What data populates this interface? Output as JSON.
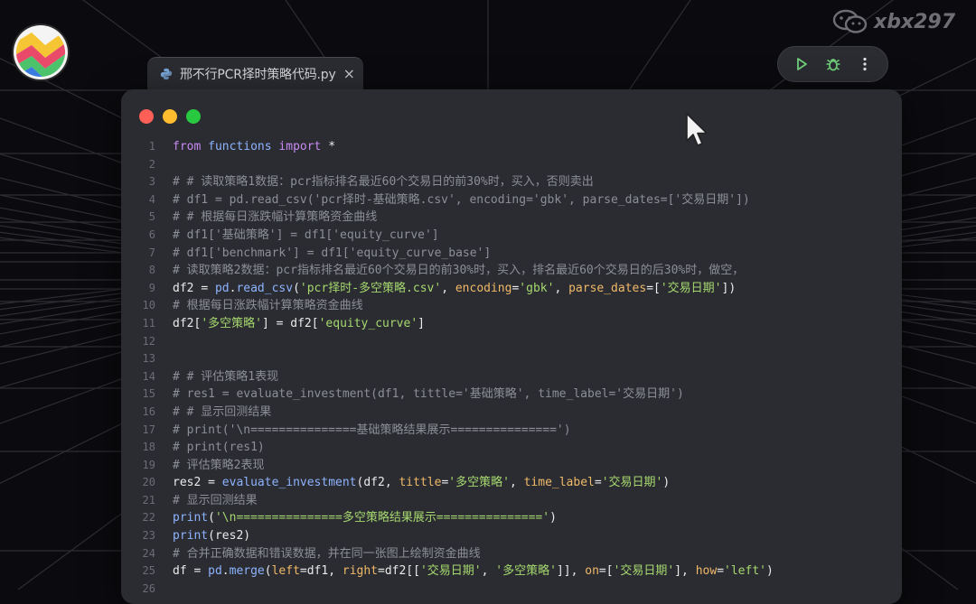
{
  "watermark": {
    "text": "xbx297"
  },
  "tab": {
    "title": "邢不行PCR择时策略代码.py",
    "close": "×"
  },
  "toolbar": {
    "run": "run-icon",
    "debug": "bug-icon",
    "more": "more-vertical-icon"
  },
  "colors": {
    "background": "#0b0b0f",
    "editor": "#2b2c31",
    "comment": "#8c8f98",
    "keyword": "#c78bf3",
    "function": "#8db3ff",
    "string": "#a6d86f",
    "parameter": "#f0b969",
    "traffic_red": "#fe5f57",
    "traffic_yellow": "#febc2e",
    "traffic_green": "#28c840"
  },
  "code_lines": [
    {
      "n": "1",
      "t": [
        [
          "kw",
          "from "
        ],
        [
          "fn",
          "functions "
        ],
        [
          "kw",
          "import "
        ],
        [
          "op",
          "*"
        ]
      ]
    },
    {
      "n": "2",
      "t": []
    },
    {
      "n": "3",
      "t": [
        [
          "cm",
          "# # 读取策略1数据：pcr指标排名最近60个交易日的前30%时，买入，否则卖出"
        ]
      ]
    },
    {
      "n": "4",
      "t": [
        [
          "cm",
          "# df1 = pd.read_csv('pcr择时-基础策略.csv', encoding='gbk', parse_dates=['交易日期'])"
        ]
      ]
    },
    {
      "n": "5",
      "t": [
        [
          "cm",
          "# # 根据每日涨跌幅计算策略资金曲线"
        ]
      ]
    },
    {
      "n": "6",
      "t": [
        [
          "cm",
          "# df1['基础策略'] = df1['equity_curve']"
        ]
      ]
    },
    {
      "n": "7",
      "t": [
        [
          "cm",
          "# df1['benchmark'] = df1['equity_curve_base']"
        ]
      ]
    },
    {
      "n": "8",
      "t": [
        [
          "cm",
          "# 读取策略2数据：pcr指标排名最近60个交易日的前30%时，买入，排名最近60个交易日的后30%时，做空，"
        ]
      ]
    },
    {
      "n": "9",
      "t": [
        [
          "var",
          "df2 "
        ],
        [
          "op",
          "= "
        ],
        [
          "fn",
          "pd"
        ],
        [
          "op",
          "."
        ],
        [
          "fn",
          "read_csv"
        ],
        [
          "op",
          "("
        ],
        [
          "str",
          "'pcr择时-多空策略.csv'"
        ],
        [
          "op",
          ", "
        ],
        [
          "param",
          "encoding"
        ],
        [
          "op",
          "="
        ],
        [
          "str",
          "'gbk'"
        ],
        [
          "op",
          ", "
        ],
        [
          "param",
          "parse_dates"
        ],
        [
          "op",
          "=["
        ],
        [
          "str",
          "'交易日期'"
        ],
        [
          "op",
          "])"
        ]
      ]
    },
    {
      "n": "10",
      "t": [
        [
          "cm",
          "# 根据每日涨跌幅计算策略资金曲线"
        ]
      ]
    },
    {
      "n": "11",
      "t": [
        [
          "var",
          "df2"
        ],
        [
          "op",
          "["
        ],
        [
          "str",
          "'多空策略'"
        ],
        [
          "op",
          "] = "
        ],
        [
          "var",
          "df2"
        ],
        [
          "op",
          "["
        ],
        [
          "str",
          "'equity_curve'"
        ],
        [
          "op",
          "]"
        ]
      ]
    },
    {
      "n": "12",
      "t": []
    },
    {
      "n": "13",
      "t": []
    },
    {
      "n": "14",
      "t": [
        [
          "cm",
          "# # 评估策略1表现"
        ]
      ]
    },
    {
      "n": "15",
      "t": [
        [
          "cm",
          "# res1 = evaluate_investment(df1, tittle='基础策略', time_label='交易日期')"
        ]
      ]
    },
    {
      "n": "16",
      "t": [
        [
          "cm",
          "# # 显示回测结果"
        ]
      ]
    },
    {
      "n": "17",
      "t": [
        [
          "cm",
          "# print('\\n===============基础策略结果展示===============')"
        ]
      ]
    },
    {
      "n": "18",
      "t": [
        [
          "cm",
          "# print(res1)"
        ]
      ]
    },
    {
      "n": "19",
      "t": [
        [
          "cm",
          "# 评估策略2表现"
        ]
      ]
    },
    {
      "n": "20",
      "t": [
        [
          "var",
          "res2 "
        ],
        [
          "op",
          "= "
        ],
        [
          "fn",
          "evaluate_investment"
        ],
        [
          "op",
          "("
        ],
        [
          "var",
          "df2"
        ],
        [
          "op",
          ", "
        ],
        [
          "param",
          "tittle"
        ],
        [
          "op",
          "="
        ],
        [
          "str",
          "'多空策略'"
        ],
        [
          "op",
          ", "
        ],
        [
          "param",
          "time_label"
        ],
        [
          "op",
          "="
        ],
        [
          "str",
          "'交易日期'"
        ],
        [
          "op",
          ")"
        ]
      ]
    },
    {
      "n": "21",
      "t": [
        [
          "cm",
          "# 显示回测结果"
        ]
      ]
    },
    {
      "n": "22",
      "t": [
        [
          "fn",
          "print"
        ],
        [
          "op",
          "("
        ],
        [
          "str",
          "'\\n===============多空策略结果展示==============='"
        ],
        [
          "op",
          ")"
        ]
      ]
    },
    {
      "n": "23",
      "t": [
        [
          "fn",
          "print"
        ],
        [
          "op",
          "("
        ],
        [
          "var",
          "res2"
        ],
        [
          "op",
          ")"
        ]
      ]
    },
    {
      "n": "24",
      "t": [
        [
          "cm",
          "# 合并正确数据和错误数据，并在同一张图上绘制资金曲线"
        ]
      ]
    },
    {
      "n": "25",
      "t": [
        [
          "var",
          "df "
        ],
        [
          "op",
          "= "
        ],
        [
          "fn",
          "pd"
        ],
        [
          "op",
          "."
        ],
        [
          "fn",
          "merge"
        ],
        [
          "op",
          "("
        ],
        [
          "param",
          "left"
        ],
        [
          "op",
          "="
        ],
        [
          "var",
          "df1"
        ],
        [
          "op",
          ", "
        ],
        [
          "param",
          "right"
        ],
        [
          "op",
          "="
        ],
        [
          "var",
          "df2"
        ],
        [
          "op",
          "[["
        ],
        [
          "str",
          "'交易日期'"
        ],
        [
          "op",
          ", "
        ],
        [
          "str",
          "'多空策略'"
        ],
        [
          "op",
          "]], "
        ],
        [
          "param",
          "on"
        ],
        [
          "op",
          "=["
        ],
        [
          "str",
          "'交易日期'"
        ],
        [
          "op",
          "], "
        ],
        [
          "param",
          "how"
        ],
        [
          "op",
          "="
        ],
        [
          "str",
          "'left'"
        ],
        [
          "op",
          ")"
        ]
      ]
    },
    {
      "n": "26",
      "t": []
    }
  ]
}
